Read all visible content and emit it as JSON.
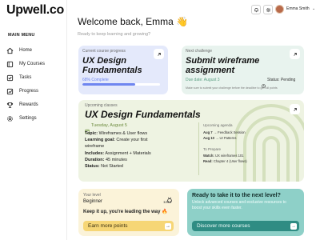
{
  "app": {
    "logo": "Upwell.co"
  },
  "sidebar": {
    "menu_title": "MAIN MENU",
    "items": [
      {
        "label": "Home",
        "icon": "home-icon"
      },
      {
        "label": "My Courses",
        "icon": "book-icon"
      },
      {
        "label": "Tasks",
        "icon": "checkbox-icon"
      },
      {
        "label": "Progress",
        "icon": "chart-icon"
      },
      {
        "label": "Rewards",
        "icon": "trophy-icon"
      },
      {
        "label": "Settings",
        "icon": "gear-icon"
      }
    ]
  },
  "header": {
    "welcome": "Welcome back, Emma 👋",
    "subtitle": "Ready to keep learning and growing?",
    "user_name": "Emma Smith",
    "user_chevron": "⌄"
  },
  "current_course": {
    "label": "Current course progress",
    "title": "UX Design Fundamentals",
    "progress_text": "68% Complete",
    "progress_value": 0.68,
    "color": "#e4e9fb"
  },
  "next_challenge": {
    "label": "Next challenge",
    "title": "Submit wireframe assignment",
    "due": "Due date: August 3",
    "status": "Status: Pending",
    "note": "Make sure to submit your challenge before the deadline to get full points",
    "color": "#e8f3ee"
  },
  "upcoming": {
    "label": "Upcoming classes",
    "title": "UX Design Fundamentals",
    "date": "Tuesday, August 5",
    "rows": [
      {
        "key": "Topic:",
        "val": "Wireframes & User flows"
      },
      {
        "key": "Learning goal:",
        "val": "Create your first"
      },
      {
        "key": "",
        "val": "wireframe"
      },
      {
        "key": "Includes:",
        "val": "Assignment + Materials"
      },
      {
        "key": "Duration:",
        "val": "45 minutes"
      },
      {
        "key": "Status:",
        "val": "Not Started"
      }
    ],
    "agenda_label": "Upcoming agenda",
    "agenda": [
      {
        "date": "Aug 7",
        "text": "→ Feedback Session"
      },
      {
        "date": "Aug 10",
        "text": "→ UI Patterns"
      }
    ],
    "prepare_label": "To Prepare",
    "prepare": [
      {
        "key": "Watch:",
        "val": "UX wireframes 101"
      },
      {
        "key": "Read:",
        "val": "Chapter 4 (User flows)"
      }
    ],
    "color": "#eef3e2"
  },
  "level": {
    "label": "Your level",
    "level": "Beginner",
    "points": "1264",
    "message": "Keep it up, you're leading the way 🔥",
    "button": "Earn more points",
    "color": "#fbf3d9",
    "button_color": "#f6d676"
  },
  "next_level": {
    "title": "Ready to take it to the next level?",
    "text": "Unlock advanced courses and exclusive resources to boost your skills even faster.",
    "button": "Discover more courses",
    "color": "#8ed0c8",
    "button_color": "#2f8c83"
  }
}
